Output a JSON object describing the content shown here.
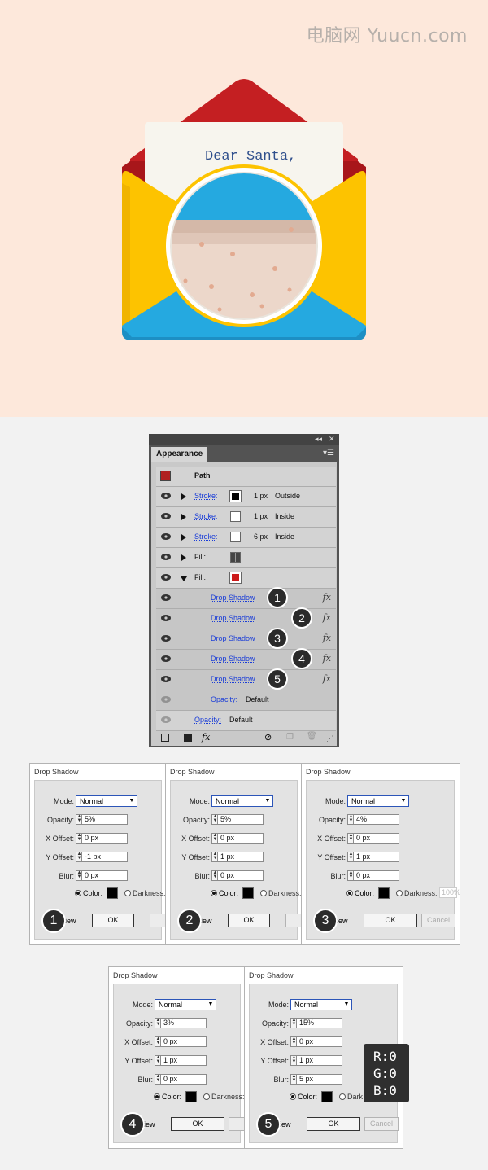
{
  "watermark": "电脑网 Yuucn.com",
  "letter": {
    "text": "Dear Santa,"
  },
  "appearance_panel": {
    "tab": "Appearance",
    "object_label": "Path",
    "rows": [
      {
        "kind": "Stroke:",
        "amount": "1 px",
        "position": "Outside",
        "swatch": "#000000"
      },
      {
        "kind": "Stroke:",
        "amount": "1 px",
        "position": "Inside",
        "swatch": "#ffffff"
      },
      {
        "kind": "Stroke:",
        "amount": "6 px",
        "position": "Inside",
        "swatch": "#ffffff"
      },
      {
        "kind": "Fill:",
        "swatch": "gradient"
      },
      {
        "kind": "Fill:",
        "swatch": "#cc1a1a"
      }
    ],
    "effects": [
      {
        "label": "Drop Shadow",
        "badge": "1"
      },
      {
        "label": "Drop Shadow",
        "badge": "2"
      },
      {
        "label": "Drop Shadow",
        "badge": "3"
      },
      {
        "label": "Drop Shadow",
        "badge": "4"
      },
      {
        "label": "Drop Shadow",
        "badge": "5"
      }
    ],
    "fill_opacity": {
      "label": "Opacity:",
      "value": "Default"
    },
    "opacity": {
      "label": "Opacity:",
      "value": "Default"
    },
    "fx_glyph": "fx"
  },
  "dialogs": [
    {
      "title": "Drop Shadow",
      "mode": "Normal",
      "opacity": "5%",
      "x_offset": "0 px",
      "y_offset": "-1 px",
      "blur": "0 px",
      "badge": "1",
      "darkness": ""
    },
    {
      "title": "Drop Shadow",
      "mode": "Normal",
      "opacity": "5%",
      "x_offset": "0 px",
      "y_offset": "1 px",
      "blur": "0 px",
      "badge": "2",
      "darkness": ""
    },
    {
      "title": "Drop Shadow",
      "mode": "Normal",
      "opacity": "4%",
      "x_offset": "0 px",
      "y_offset": "1 px",
      "blur": "0 px",
      "badge": "3",
      "darkness": "100%"
    },
    {
      "title": "Drop Shadow",
      "mode": "Normal",
      "opacity": "3%",
      "x_offset": "0 px",
      "y_offset": "1 px",
      "blur": "0 px",
      "badge": "4",
      "darkness": ""
    },
    {
      "title": "Drop Shadow",
      "mode": "Normal",
      "opacity": "15%",
      "x_offset": "0 px",
      "y_offset": "1 px",
      "blur": "5 px",
      "badge": "5",
      "darkness": ""
    }
  ],
  "dialog_labels": {
    "mode": "Mode:",
    "opacity": "Opacity:",
    "x_offset": "X Offset:",
    "y_offset": "Y Offset:",
    "blur": "Blur:",
    "color": "Color:",
    "darkness": "Darkness:",
    "preview": "iew",
    "ok": "OK",
    "cancel": "Cancel",
    "darkness_short": "Dark"
  },
  "rgb_tooltip": {
    "r": "R:0",
    "g": "G:0",
    "b": "B:0"
  },
  "colors": {
    "envelope_red": "#c41f22",
    "envelope_yellow": "#fdc300",
    "envelope_blue": "#25a9e0",
    "background": "#fde8db"
  }
}
